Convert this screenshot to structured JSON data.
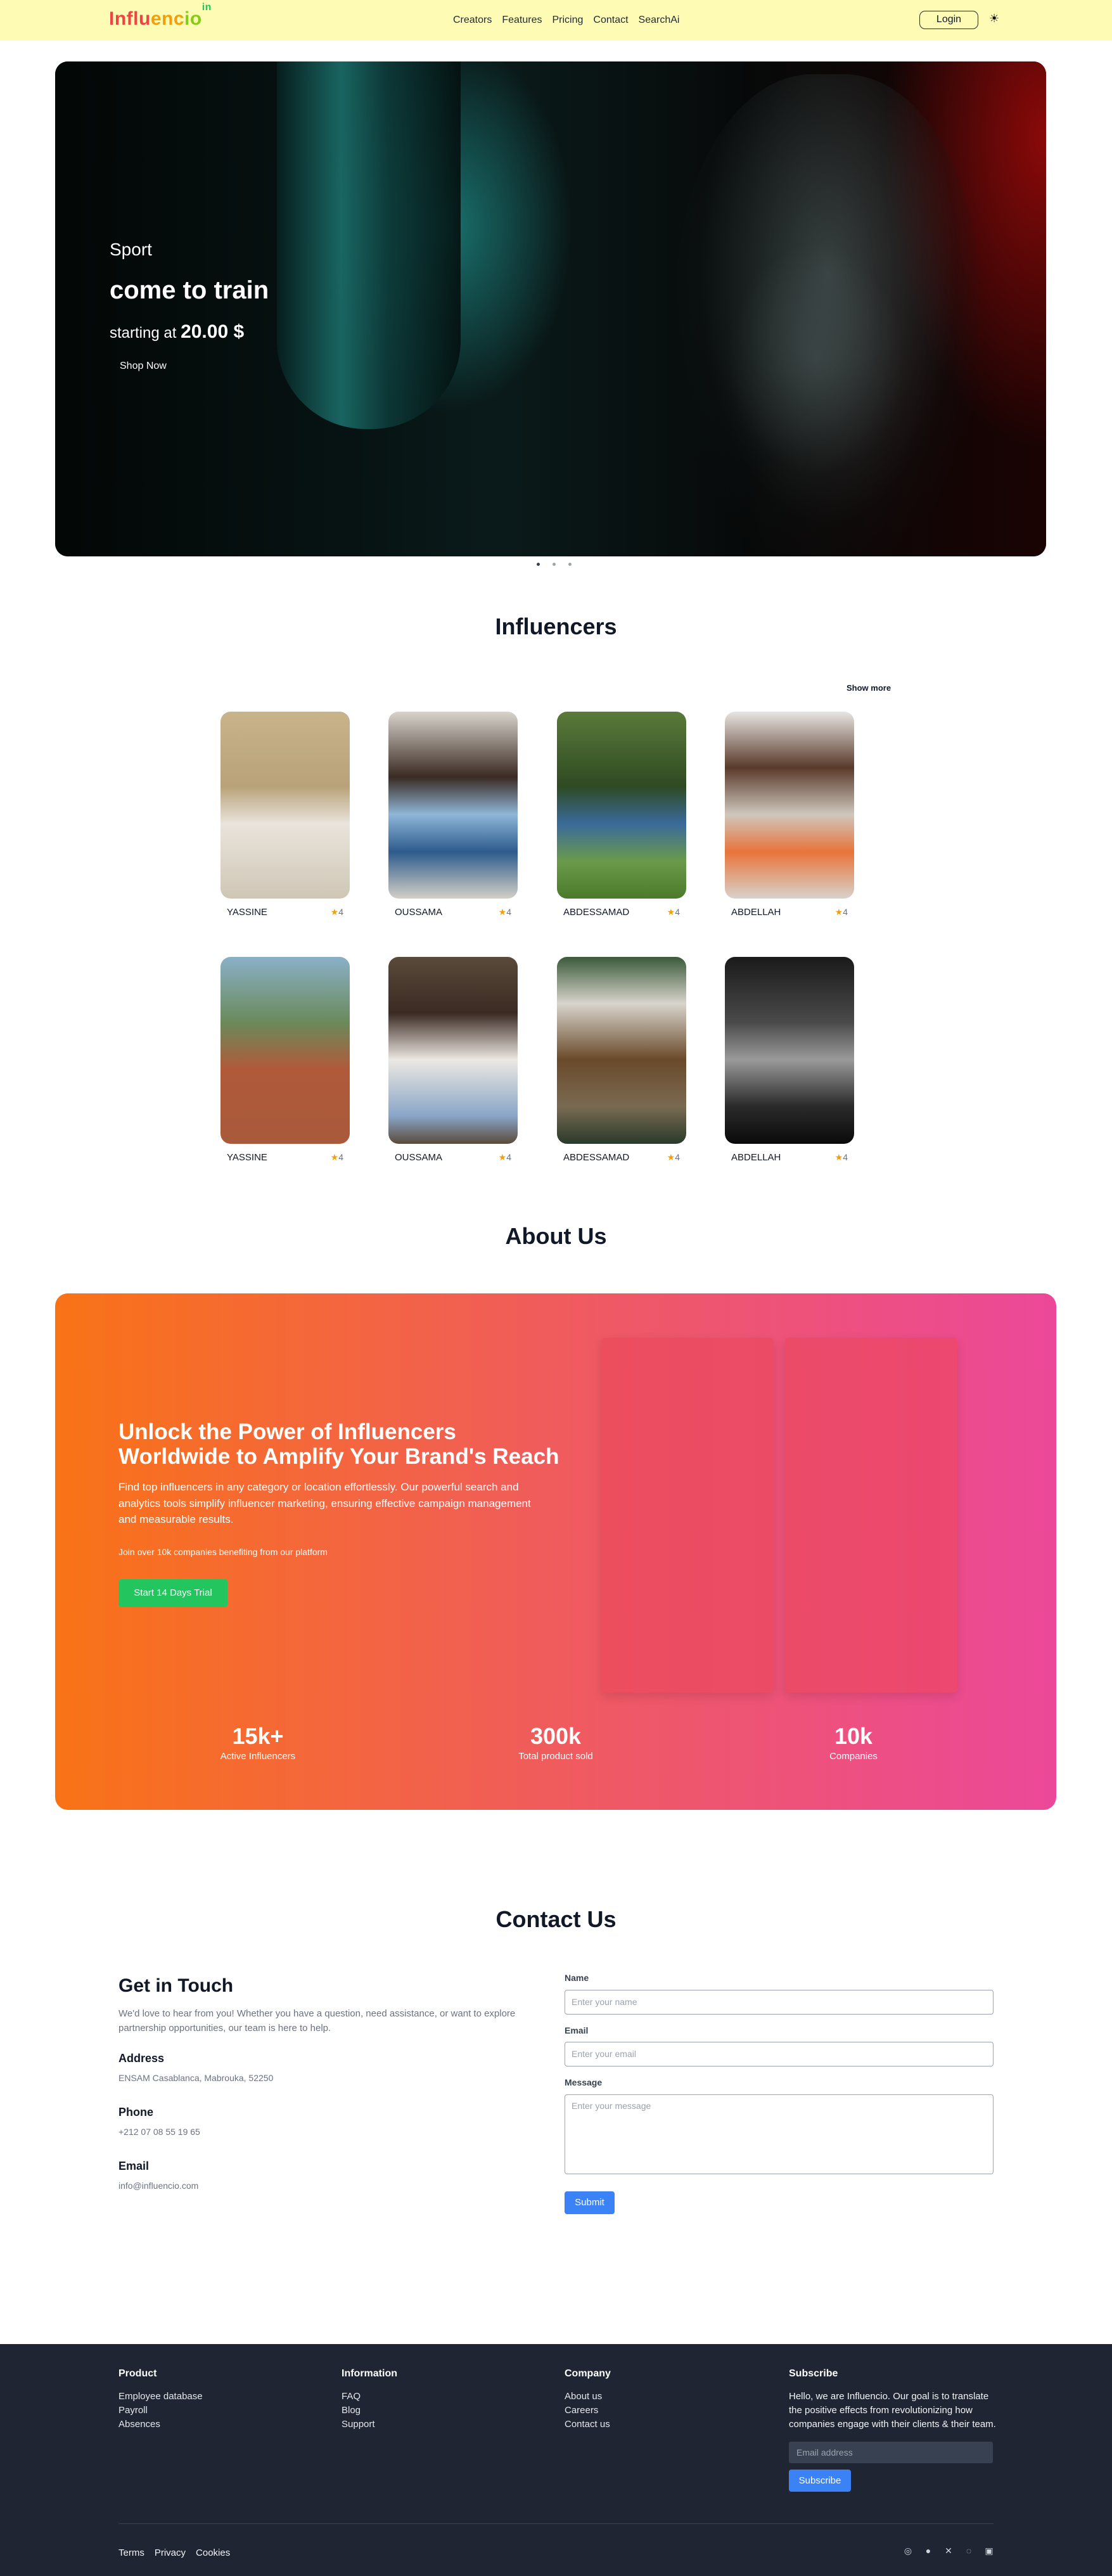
{
  "nav": {
    "logo_part1": "Influ",
    "logo_part2": "enc",
    "logo_part3": "io",
    "logo_sup": "in",
    "links": [
      "Creators",
      "Features",
      "Pricing",
      "Contact",
      "SearchAi"
    ],
    "login_label": "Login",
    "theme_icon": "☀"
  },
  "hero": {
    "eyebrow": "Sport",
    "title": "come to train",
    "price_prefix": "starting at",
    "price": "20.00 $",
    "button": "Shop Now",
    "slide_count": 3,
    "active_slide": 1
  },
  "influencers": {
    "title": "Influencers",
    "show_more": "Show more",
    "cards": [
      {
        "name": "YASSINE",
        "rating": "4"
      },
      {
        "name": "OUSSAMA",
        "rating": "4"
      },
      {
        "name": "ABDESSAMAD",
        "rating": "4"
      },
      {
        "name": "ABDELLAH",
        "rating": "4"
      },
      {
        "name": "YASSINE",
        "rating": "4"
      },
      {
        "name": "OUSSAMA",
        "rating": "4"
      },
      {
        "name": "ABDESSAMAD",
        "rating": "4"
      },
      {
        "name": "ABDELLAH",
        "rating": "4"
      }
    ],
    "star": "★"
  },
  "about": {
    "title": "About Us",
    "headline": "Unlock the Power of Influencers Worldwide to Amplify Your Brand's Reach",
    "description": "Find top influencers in any category or location effortlessly. Our powerful search and analytics tools simplify influencer marketing, ensuring effective campaign management and measurable results.",
    "join": "Join over 10k companies benefiting from our platform",
    "trial_button": "Start 14 Days Trial",
    "stats": [
      {
        "value": "15k+",
        "label": "Active Influencers"
      },
      {
        "value": "300k",
        "label": "Total product sold"
      },
      {
        "value": "10k",
        "label": "Companies"
      }
    ]
  },
  "contact": {
    "title": "Contact Us",
    "heading": "Get in Touch",
    "intro": "We'd love to hear from you! Whether you have a question, need assistance, or want to explore partnership opportunities, our team is here to help.",
    "address_label": "Address",
    "address": "ENSAM Casablanca, Mabrouka, 52250",
    "phone_label": "Phone",
    "phone": "+212 07 08 55 19 65",
    "email_label": "Email",
    "email": "info@influencio.com",
    "form": {
      "name_label": "Name",
      "name_placeholder": "Enter your name",
      "email_label": "Email",
      "email_placeholder": "Enter your email",
      "message_label": "Message",
      "message_placeholder": "Enter your message",
      "submit": "Submit"
    }
  },
  "footer": {
    "product": {
      "title": "Product",
      "links": [
        "Employee database",
        "Payroll",
        "Absences"
      ]
    },
    "information": {
      "title": "Information",
      "links": [
        "FAQ",
        "Blog",
        "Support"
      ]
    },
    "company": {
      "title": "Company",
      "links": [
        "About us",
        "Careers",
        "Contact us"
      ]
    },
    "subscribe": {
      "title": "Subscribe",
      "blurb": "Hello, we are Influencio. Our goal is to translate the positive effects from revolutionizing how companies engage with their clients & their team.",
      "email_placeholder": "Email address",
      "button": "Subscribe"
    },
    "legal": [
      "Terms",
      "Privacy",
      "Cookies"
    ],
    "social_icons": [
      "instagram-icon",
      "facebook-icon",
      "x-icon",
      "whatsapp-icon",
      "linkedin-icon"
    ]
  }
}
